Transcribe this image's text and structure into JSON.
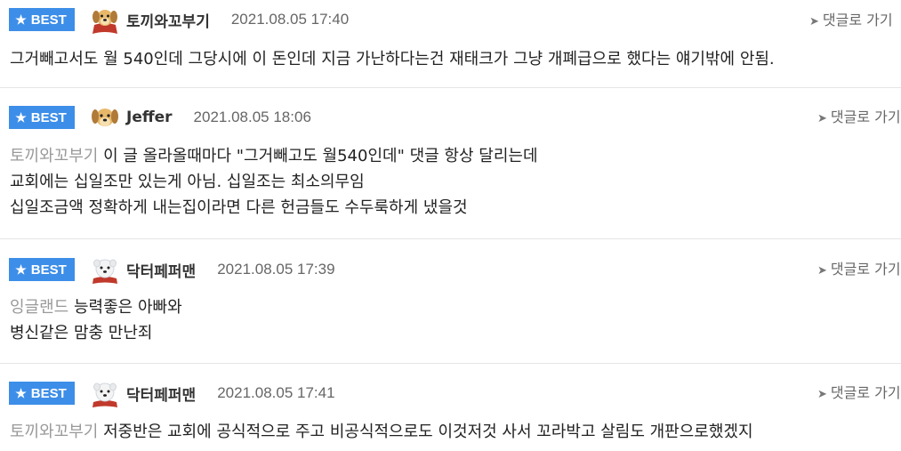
{
  "best_label": "BEST",
  "reply_label": "댓글로 가기",
  "comments": [
    {
      "nickname": "토끼와꼬부기",
      "avatar": "puppy-cape-icon",
      "date": "2021.08.05 17:40",
      "lines": [
        {
          "mention": "",
          "text": "그거빼고서도 월 540인데 그당시에 이 돈인데 지금 가난하다는건 재태크가 그냥 개폐급으로 했다는 얘기밖에 안됨."
        }
      ]
    },
    {
      "nickname": "Jeffer",
      "avatar": "puppy-icon",
      "date": "2021.08.05 18:06",
      "lines": [
        {
          "mention": "토끼와꼬부기",
          "text": "이 글 올라올때마다 \"그거빼고도 월540인데\" 댓글 항상 달리는데"
        },
        {
          "mention": "",
          "text": "교회에는 십일조만 있는게 아님. 십일조는 최소의무임"
        },
        {
          "mention": "",
          "text": "십일조금액 정확하게 내는집이라면 다른 헌금들도 수두룩하게 냈을것"
        }
      ]
    },
    {
      "nickname": "닥터페퍼맨",
      "avatar": "white-puppy-icon",
      "date": "2021.08.05 17:39",
      "lines": [
        {
          "mention": "잉글랜드",
          "text": "능력좋은 아빠와"
        },
        {
          "mention": "",
          "text": "병신같은 맘충 만난죄"
        }
      ]
    },
    {
      "nickname": "닥터페퍼맨",
      "avatar": "white-puppy-icon",
      "date": "2021.08.05 17:41",
      "lines": [
        {
          "mention": "토끼와꼬부기",
          "text": "저중반은 교회에 공식적으로 주고 비공식적으로도 이것저것 사서 꼬라박고 살림도 개판으로했겠지"
        }
      ]
    }
  ]
}
